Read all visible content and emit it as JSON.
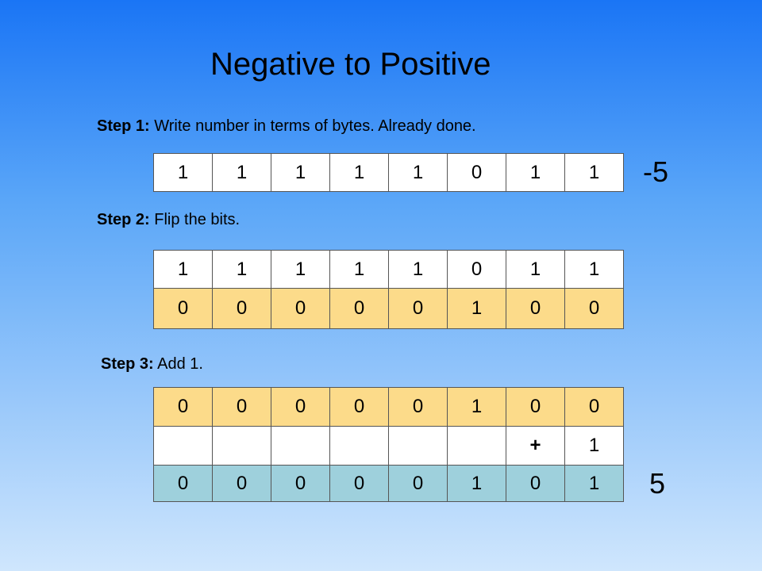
{
  "title": "Negative to Positive",
  "step1": {
    "label": "Step 1:",
    "text": " Write number in terms of bytes. Already done."
  },
  "step2": {
    "label": "Step 2:",
    "text": " Flip the bits."
  },
  "step3": {
    "label": "Step 3:",
    "text": " Add 1."
  },
  "table1": {
    "row": [
      "1",
      "1",
      "1",
      "1",
      "1",
      "0",
      "1",
      "1"
    ],
    "value_label": "-5"
  },
  "table2": {
    "original": [
      "1",
      "1",
      "1",
      "1",
      "1",
      "0",
      "1",
      "1"
    ],
    "flipped": [
      "0",
      "0",
      "0",
      "0",
      "0",
      "1",
      "0",
      "0"
    ]
  },
  "table3": {
    "flipped": [
      "0",
      "0",
      "0",
      "0",
      "0",
      "1",
      "0",
      "0"
    ],
    "addend": [
      "",
      "",
      "",
      "",
      "",
      "",
      "+",
      "1"
    ],
    "result": [
      "0",
      "0",
      "0",
      "0",
      "0",
      "1",
      "0",
      "1"
    ],
    "value_label": "5"
  },
  "colors": {
    "background_top": "#1a75f5",
    "background_bottom": "#cfe6fd",
    "flipped_row": "#fcdb8a",
    "result_row": "#9ed0dc"
  }
}
